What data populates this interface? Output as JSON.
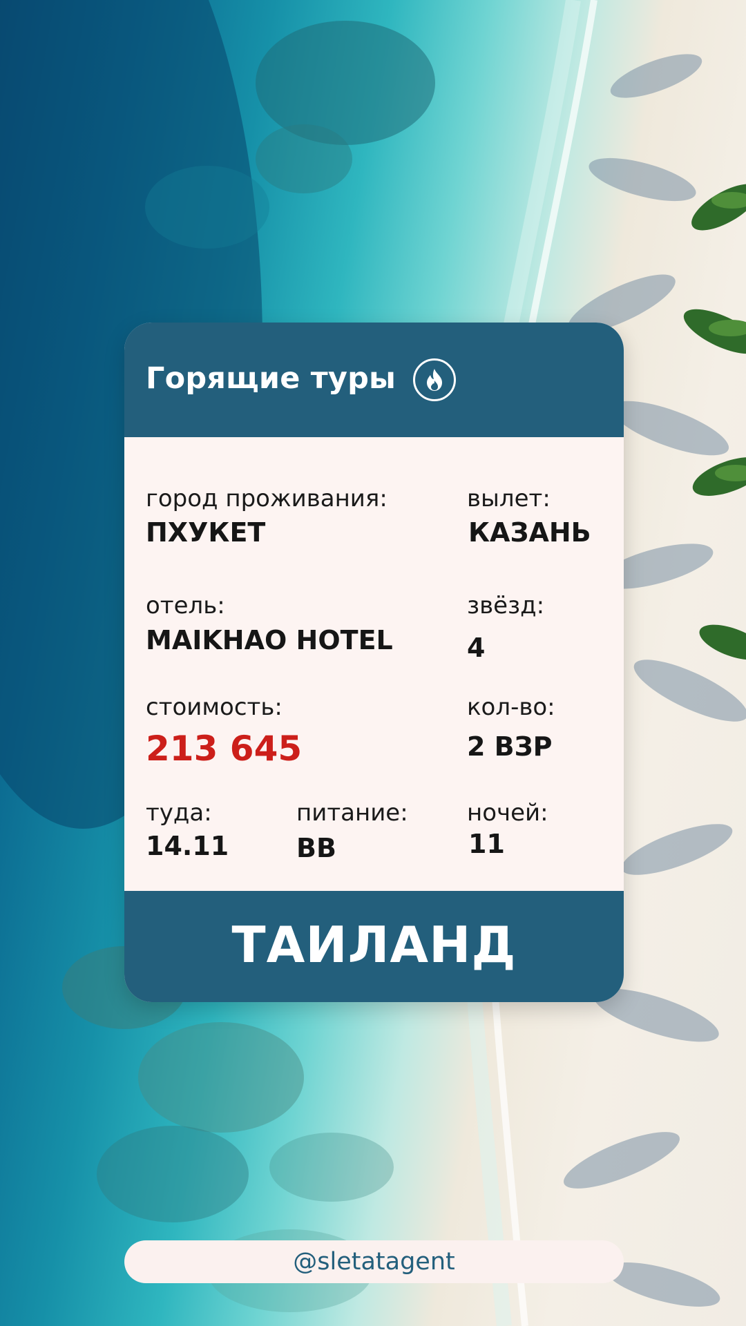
{
  "card": {
    "title": "Горящие туры",
    "badge_icon": "fire-icon",
    "fields": {
      "city_label": "город проживания:",
      "city_value": "ПХУКЕТ",
      "departure_label": "вылет:",
      "departure_value": "КАЗАНЬ",
      "hotel_label": "отель:",
      "hotel_value": "MAIKHAO HOTEL",
      "stars_label": "звёзд:",
      "stars_value": "4",
      "price_label": "стоимость:",
      "price_value": "213 645",
      "guests_label": "кол-во:",
      "guests_value": "2 ВЗР",
      "date_label": "туда:",
      "date_value": "14.11",
      "meal_label": "питание:",
      "meal_value": "BB",
      "nights_label": "ночей:",
      "nights_value": "11"
    },
    "country": "ТАИЛАНД"
  },
  "handle": "@sletatagent",
  "colors": {
    "header_bg": "#235f7c",
    "card_bg": "#fdf4f2",
    "price": "#cc1f1a",
    "handle_text": "#235f7c"
  }
}
